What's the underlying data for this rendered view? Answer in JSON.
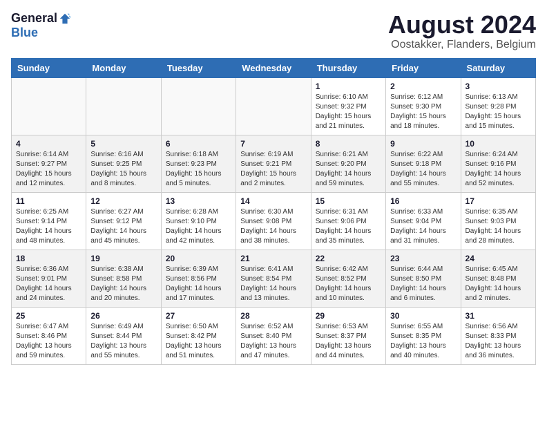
{
  "header": {
    "logo_general": "General",
    "logo_blue": "Blue",
    "month_title": "August 2024",
    "location": "Oostakker, Flanders, Belgium"
  },
  "weekdays": [
    "Sunday",
    "Monday",
    "Tuesday",
    "Wednesday",
    "Thursday",
    "Friday",
    "Saturday"
  ],
  "weeks": [
    [
      {
        "day": "",
        "info": ""
      },
      {
        "day": "",
        "info": ""
      },
      {
        "day": "",
        "info": ""
      },
      {
        "day": "",
        "info": ""
      },
      {
        "day": "1",
        "info": "Sunrise: 6:10 AM\nSunset: 9:32 PM\nDaylight: 15 hours\nand 21 minutes."
      },
      {
        "day": "2",
        "info": "Sunrise: 6:12 AM\nSunset: 9:30 PM\nDaylight: 15 hours\nand 18 minutes."
      },
      {
        "day": "3",
        "info": "Sunrise: 6:13 AM\nSunset: 9:28 PM\nDaylight: 15 hours\nand 15 minutes."
      }
    ],
    [
      {
        "day": "4",
        "info": "Sunrise: 6:14 AM\nSunset: 9:27 PM\nDaylight: 15 hours\nand 12 minutes."
      },
      {
        "day": "5",
        "info": "Sunrise: 6:16 AM\nSunset: 9:25 PM\nDaylight: 15 hours\nand 8 minutes."
      },
      {
        "day": "6",
        "info": "Sunrise: 6:18 AM\nSunset: 9:23 PM\nDaylight: 15 hours\nand 5 minutes."
      },
      {
        "day": "7",
        "info": "Sunrise: 6:19 AM\nSunset: 9:21 PM\nDaylight: 15 hours\nand 2 minutes."
      },
      {
        "day": "8",
        "info": "Sunrise: 6:21 AM\nSunset: 9:20 PM\nDaylight: 14 hours\nand 59 minutes."
      },
      {
        "day": "9",
        "info": "Sunrise: 6:22 AM\nSunset: 9:18 PM\nDaylight: 14 hours\nand 55 minutes."
      },
      {
        "day": "10",
        "info": "Sunrise: 6:24 AM\nSunset: 9:16 PM\nDaylight: 14 hours\nand 52 minutes."
      }
    ],
    [
      {
        "day": "11",
        "info": "Sunrise: 6:25 AM\nSunset: 9:14 PM\nDaylight: 14 hours\nand 48 minutes."
      },
      {
        "day": "12",
        "info": "Sunrise: 6:27 AM\nSunset: 9:12 PM\nDaylight: 14 hours\nand 45 minutes."
      },
      {
        "day": "13",
        "info": "Sunrise: 6:28 AM\nSunset: 9:10 PM\nDaylight: 14 hours\nand 42 minutes."
      },
      {
        "day": "14",
        "info": "Sunrise: 6:30 AM\nSunset: 9:08 PM\nDaylight: 14 hours\nand 38 minutes."
      },
      {
        "day": "15",
        "info": "Sunrise: 6:31 AM\nSunset: 9:06 PM\nDaylight: 14 hours\nand 35 minutes."
      },
      {
        "day": "16",
        "info": "Sunrise: 6:33 AM\nSunset: 9:04 PM\nDaylight: 14 hours\nand 31 minutes."
      },
      {
        "day": "17",
        "info": "Sunrise: 6:35 AM\nSunset: 9:03 PM\nDaylight: 14 hours\nand 28 minutes."
      }
    ],
    [
      {
        "day": "18",
        "info": "Sunrise: 6:36 AM\nSunset: 9:01 PM\nDaylight: 14 hours\nand 24 minutes."
      },
      {
        "day": "19",
        "info": "Sunrise: 6:38 AM\nSunset: 8:58 PM\nDaylight: 14 hours\nand 20 minutes."
      },
      {
        "day": "20",
        "info": "Sunrise: 6:39 AM\nSunset: 8:56 PM\nDaylight: 14 hours\nand 17 minutes."
      },
      {
        "day": "21",
        "info": "Sunrise: 6:41 AM\nSunset: 8:54 PM\nDaylight: 14 hours\nand 13 minutes."
      },
      {
        "day": "22",
        "info": "Sunrise: 6:42 AM\nSunset: 8:52 PM\nDaylight: 14 hours\nand 10 minutes."
      },
      {
        "day": "23",
        "info": "Sunrise: 6:44 AM\nSunset: 8:50 PM\nDaylight: 14 hours\nand 6 minutes."
      },
      {
        "day": "24",
        "info": "Sunrise: 6:45 AM\nSunset: 8:48 PM\nDaylight: 14 hours\nand 2 minutes."
      }
    ],
    [
      {
        "day": "25",
        "info": "Sunrise: 6:47 AM\nSunset: 8:46 PM\nDaylight: 13 hours\nand 59 minutes."
      },
      {
        "day": "26",
        "info": "Sunrise: 6:49 AM\nSunset: 8:44 PM\nDaylight: 13 hours\nand 55 minutes."
      },
      {
        "day": "27",
        "info": "Sunrise: 6:50 AM\nSunset: 8:42 PM\nDaylight: 13 hours\nand 51 minutes."
      },
      {
        "day": "28",
        "info": "Sunrise: 6:52 AM\nSunset: 8:40 PM\nDaylight: 13 hours\nand 47 minutes."
      },
      {
        "day": "29",
        "info": "Sunrise: 6:53 AM\nSunset: 8:37 PM\nDaylight: 13 hours\nand 44 minutes."
      },
      {
        "day": "30",
        "info": "Sunrise: 6:55 AM\nSunset: 8:35 PM\nDaylight: 13 hours\nand 40 minutes."
      },
      {
        "day": "31",
        "info": "Sunrise: 6:56 AM\nSunset: 8:33 PM\nDaylight: 13 hours\nand 36 minutes."
      }
    ]
  ]
}
